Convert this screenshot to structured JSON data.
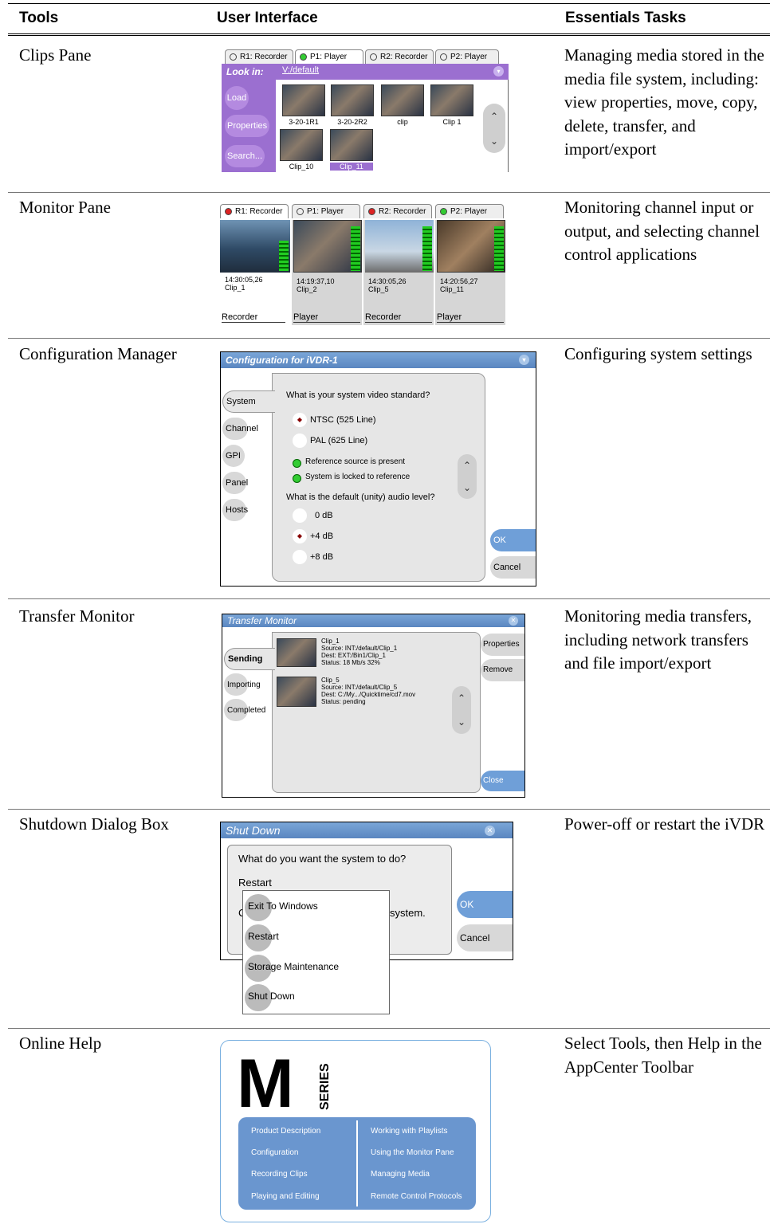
{
  "headers": {
    "tools": "Tools",
    "ui": "User Interface",
    "tasks": "Essentials Tasks"
  },
  "rows": [
    {
      "tool": "Clips Pane",
      "task": "Managing media stored in the media file system, including: view properties, move, copy, delete, transfer, and import/export"
    },
    {
      "tool": "Monitor Pane",
      "task": "Monitoring channel input or output, and selecting channel control applications"
    },
    {
      "tool": "Configuration Manager",
      "task": "Configuring system settings"
    },
    {
      "tool": "Transfer Monitor",
      "task": "Monitoring media transfers, including network transfers and file import/export"
    },
    {
      "tool": "Shutdown Dialog Box",
      "task": "Power-off or restart the iVDR"
    },
    {
      "tool": "Online Help",
      "task": "Select Tools, then Help in the AppCenter Toolbar"
    }
  ],
  "clips": {
    "tabs": [
      "R1: Recorder",
      "P1: Player",
      "R2: Recorder",
      "P2: Player"
    ],
    "look_in": "Look in:",
    "path": "V:/default",
    "buttons": [
      "Load",
      "Properties",
      "Search..."
    ],
    "clips": [
      "3-20-1R1",
      "3-20-2R2",
      "clip",
      "Clip 1",
      "Clip_10",
      "Clip_11"
    ]
  },
  "monitor": {
    "tabs": [
      "R1: Recorder",
      "P1: Player",
      "R2: Recorder",
      "P2: Player"
    ],
    "channels": [
      {
        "tc": "14:30:05,26",
        "clip": "Clip_1",
        "mode": "Recorder"
      },
      {
        "tc": "14:19:37,10",
        "clip": "Clip_2",
        "mode": "Player"
      },
      {
        "tc": "14:30:05,26",
        "clip": "Clip_5",
        "mode": "Recorder"
      },
      {
        "tc": "14:20:56,27",
        "clip": "Clip_11",
        "mode": "Player"
      }
    ]
  },
  "config": {
    "title": "Configuration for iVDR-1",
    "side": [
      "System",
      "Channel",
      "GPI",
      "Panel",
      "Hosts"
    ],
    "q1": "What is your system video standard?",
    "opt1": "NTSC (525 Line)",
    "opt2": "PAL (625 Line)",
    "s1": "Reference source is present",
    "s2": "System is locked to reference",
    "q2": "What is the default (unity) audio level?",
    "a1": "0 dB",
    "a2": "+4 dB",
    "a3": "+8 dB",
    "ok": "OK",
    "cancel": "Cancel"
  },
  "transfer": {
    "title": "Transfer Monitor",
    "side": [
      "Sending",
      "Importing",
      "Completed"
    ],
    "t1": {
      "name": "Clip_1",
      "source": "Source:  INT:/default/Clip_1",
      "dest": "Dest:  EXT:/Bin1/Clip_1",
      "status": "Status:  18 Mb/s    32%"
    },
    "t2": {
      "name": "Clip_5",
      "source": "Source:  INT:/default/Clip_5",
      "dest": "Dest:  C:/My.../Quicktime/cd7.mov",
      "status": "Status:  pending"
    },
    "properties": "Properties",
    "remove": "Remove",
    "close": "Close"
  },
  "shutdown": {
    "title": "Shut Down",
    "question": "What do you want the system to do?",
    "selected": "Restart",
    "trail": "system.",
    "lead": "C",
    "menu": [
      "Exit To Windows",
      "Restart",
      "Storage Maintenance",
      "Shut Down"
    ],
    "ok": "OK",
    "cancel": "Cancel"
  },
  "help": {
    "logo": "M",
    "logo_sub": "SERIES",
    "left": [
      "Product Description",
      "Configuration",
      "Recording Clips",
      "Playing and Editing"
    ],
    "right": [
      "Working with Playlists",
      "Using the Monitor Pane",
      "Managing Media",
      "Remote Control Protocols"
    ]
  }
}
